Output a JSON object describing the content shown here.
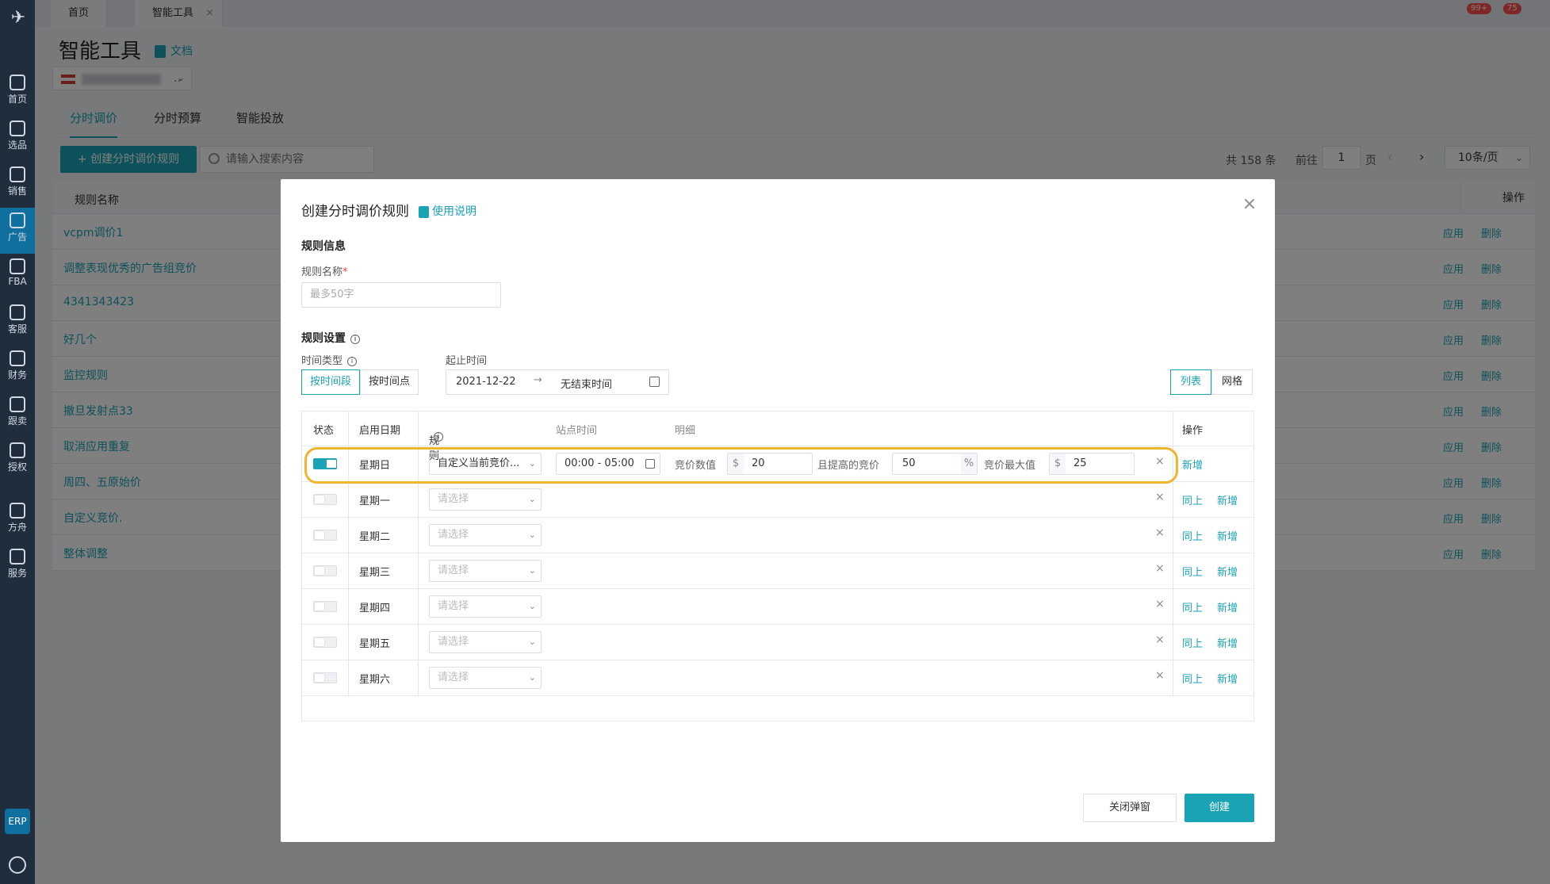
{
  "sidebar": {
    "items": [
      {
        "label": "首页"
      },
      {
        "label": "选品"
      },
      {
        "label": "销售"
      },
      {
        "label": "广告"
      },
      {
        "label": "FBA"
      },
      {
        "label": "客服"
      },
      {
        "label": "财务"
      },
      {
        "label": "跟卖"
      },
      {
        "label": "授权"
      },
      {
        "label": "方舟"
      },
      {
        "label": "服务"
      }
    ],
    "erp_label": "ERP"
  },
  "topbar": {
    "tabs": [
      {
        "label": "首页"
      },
      {
        "label": "智能工具"
      }
    ],
    "close_icon": "×",
    "notify_badge": "99+",
    "bell_badge": "75"
  },
  "page": {
    "title": "智能工具",
    "doc_link": "文档",
    "store_suffix": ".."
  },
  "main_tabs": [
    {
      "label": "分时调价"
    },
    {
      "label": "分时预算"
    },
    {
      "label": "智能投放"
    }
  ],
  "toolbar": {
    "create_label": "+ 创建分时调价规则",
    "search_placeholder": "请输入搜索内容"
  },
  "pager": {
    "total": "共 158 条",
    "goto": "前往",
    "page": "1",
    "page_unit": "页",
    "size": "10条/页"
  },
  "rules_table": {
    "col_name": "规则名称",
    "col_action": "操作",
    "apply": "应用",
    "delete": "删除",
    "rows": [
      "vcpm调价1",
      "调整表现优秀的广告组竞价",
      "4341343423",
      "好几个",
      "监控规则",
      "撤旦发射点33",
      "取消应用重复",
      "周四、五原始价",
      "自定义竞价.",
      "整体调整"
    ]
  },
  "modal": {
    "title": "创建分时调价规则",
    "help": "使用说明",
    "close": "×",
    "section_info": "规则信息",
    "name_label": "规则名称",
    "name_required": "*",
    "name_placeholder": "最多50字",
    "section_settings": "规则设置",
    "time_type_label": "时间类型",
    "time_type_options": [
      "按时间段",
      "按时间点"
    ],
    "start_end_label": "起止时间",
    "start_date": "2021-12-22",
    "range_arrow": "→",
    "end_date": "无结束时间",
    "view_options": [
      "列表",
      "网格"
    ],
    "info_icon": "i",
    "table": {
      "headers": {
        "status": "状态",
        "date": "启用日期",
        "rule": "规则",
        "site_time": "站点时间",
        "detail": "明细",
        "action": "操作"
      },
      "placeholder": "请选择",
      "same_above": "同上",
      "add": "新增",
      "remove": "×",
      "first_row": {
        "day": "星期日",
        "rule": "自定义当前竞价...",
        "time": "00:00 - 05:00",
        "bid_label": "竞价数值",
        "bid_unit": "$",
        "bid_value": "20",
        "raise_label": "且提高的竞价",
        "raise_value": "50",
        "raise_unit": "%",
        "max_label": "竞价最大值",
        "max_unit": "$",
        "max_value": "25"
      },
      "days": [
        "星期一",
        "星期二",
        "星期三",
        "星期四",
        "星期五",
        "星期六"
      ]
    },
    "btn_close": "关闭弹窗",
    "btn_create": "创建"
  }
}
